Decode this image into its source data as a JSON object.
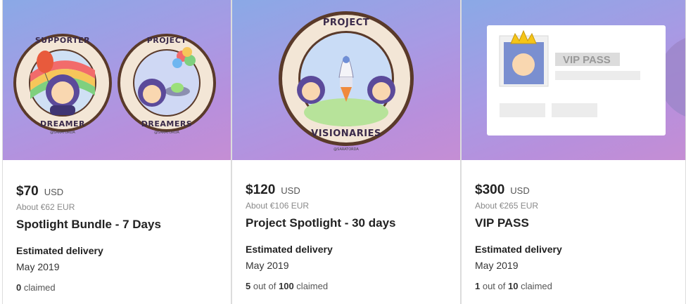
{
  "rewards": [
    {
      "price": "$70",
      "currency": "USD",
      "converted": "About €62 EUR",
      "title": "Spotlight Bundle - 7 Days",
      "delivery_label": "Estimated delivery",
      "delivery_date": "May 2019",
      "claimed_count": "0",
      "claimed_suffix": " claimed",
      "badges": [
        {
          "top": "SUPPORTER",
          "bottom": "DREAMER",
          "credit": "@SARATORDA"
        },
        {
          "top": "PROJECT",
          "bottom": "DREAMERS",
          "credit": "@SARATORDA"
        }
      ]
    },
    {
      "price": "$120",
      "currency": "USD",
      "converted": "About €106 EUR",
      "title": "Project Spotlight - 30 days",
      "delivery_label": "Estimated delivery",
      "delivery_date": "May 2019",
      "claimed_count": "5",
      "claimed_mid": " out of ",
      "claimed_limit": "100",
      "claimed_suffix": " claimed",
      "badge": {
        "top": "PROJECT",
        "bottom": "VISIONARIES",
        "credit": "@SARATORDA"
      }
    },
    {
      "price": "$300",
      "currency": "USD",
      "converted": "About €265 EUR",
      "title": "VIP PASS",
      "delivery_label": "Estimated delivery",
      "delivery_date": "May 2019",
      "claimed_count": "1",
      "claimed_mid": " out of ",
      "claimed_limit": "10",
      "claimed_suffix": " claimed",
      "pass_label": "VIP PASS"
    }
  ],
  "colors": {
    "badge_ring": "#f3e6d6",
    "badge_outline": "#5a3a2a",
    "helmet": "#5b4a9a",
    "rocket_flame": "#f08a3c",
    "crown": "#f5c518"
  }
}
